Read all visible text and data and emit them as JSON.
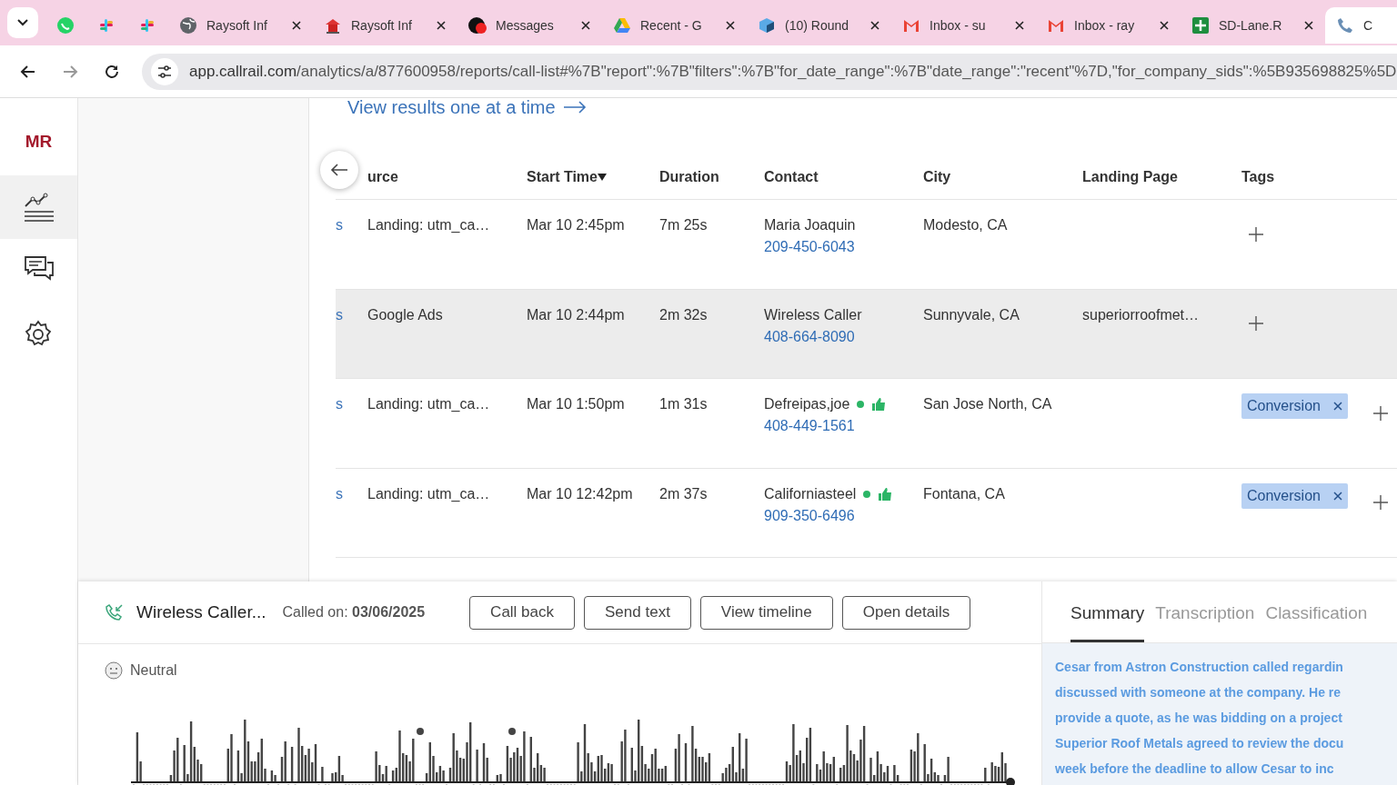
{
  "browser": {
    "tabs": [
      {
        "kind": "chat",
        "selected": false
      },
      {
        "kind": "pinwheel",
        "selected": false
      },
      {
        "kind": "pinwheel",
        "selected": false
      },
      {
        "kind": "globe",
        "title": "Raysoft Inf",
        "selected": false
      },
      {
        "kind": "house",
        "title": "Raysoft Inf",
        "selected": false
      },
      {
        "kind": "badge",
        "title": "Messages",
        "selected": false
      },
      {
        "kind": "triangle",
        "title": "Recent - G",
        "selected": false
      },
      {
        "kind": "cube",
        "title": "(10) Round",
        "selected": false
      },
      {
        "kind": "mail",
        "title": "Inbox - su",
        "selected": false
      },
      {
        "kind": "mail",
        "title": "Inbox - ray",
        "selected": false
      },
      {
        "kind": "sheet",
        "title": "SD-Lane.R",
        "selected": false
      },
      {
        "kind": "phone",
        "title": "C",
        "selected": true
      }
    ],
    "url_host": "app.callrail.com",
    "url_path": "/analytics/a/877600958/reports/call-list#%7B\"report\":%7B\"filters\":%7B\"for_date_range\":%7B\"date_range\":\"recent\"%7D,\"for_company_sids\":%5B935698825%5D"
  },
  "sidebar": {
    "logo": "MR",
    "items": [
      {
        "kind": "chart",
        "selected": true
      },
      {
        "kind": "chat",
        "selected": false
      },
      {
        "kind": "gear",
        "selected": false
      }
    ]
  },
  "view_link": "View results one at a time",
  "table": {
    "columns": [
      "urce",
      "Start Time",
      "Duration",
      "Contact",
      "City",
      "Landing Page",
      "Tags"
    ],
    "rows": [
      {
        "column_1": "s",
        "source": "Landing: utm_ca…",
        "start_time": "Mar 10 2:45pm",
        "duration": "7m 25s",
        "contact": "Maria Joaquin",
        "phone": "209-450-6043",
        "status": false,
        "city": "Modesto, CA",
        "selected": false
      },
      {
        "column_1": "s",
        "source": "Google Ads",
        "start_time": "Mar 10 2:44pm",
        "duration": "2m 32s",
        "contact": "Wireless Caller",
        "phone": "408-664-8090",
        "status": false,
        "city": "Sunnyvale, CA",
        "landing_page": "superiorroofmet…",
        "selected": true
      },
      {
        "column_1": "s",
        "source": "Landing: utm_ca…",
        "start_time": "Mar 10 1:50pm",
        "duration": "1m 31s",
        "contact": "Defreipas,joe",
        "phone": "408-449-1561",
        "status": true,
        "city": "San Jose North, CA",
        "tags": [
          "Conversion"
        ],
        "selected": false
      },
      {
        "column_1": "s",
        "source": "Landing: utm_ca…",
        "start_time": "Mar 10 12:42pm",
        "duration": "2m 37s",
        "contact": "Californiasteel",
        "phone": "909-350-6496",
        "status": true,
        "city": "Fontana, CA",
        "tags": [
          "Conversion"
        ],
        "selected": false
      }
    ]
  },
  "call_panel": {
    "caller": "Wireless Caller...",
    "called_on": "Called on: **03/06/2025**",
    "buttons": [
      "Call back",
      "Send text",
      "View timeline",
      "Open details"
    ],
    "sentiment": "Neutral",
    "tabs": [
      {
        "label": "Summary",
        "selected": true
      },
      {
        "label": "Transcription",
        "selected": false
      },
      {
        "label": "Classification",
        "selected": false
      }
    ],
    "summary_lines": [
      "Cesar from Astron Construction called regardin",
      "discussed with someone at the company. He re",
      "provide a quote, as he was bidding on a project",
      "Superior Roof Metals agreed to review the docu",
      "week before the deadline to allow Cesar to inc"
    ]
  }
}
